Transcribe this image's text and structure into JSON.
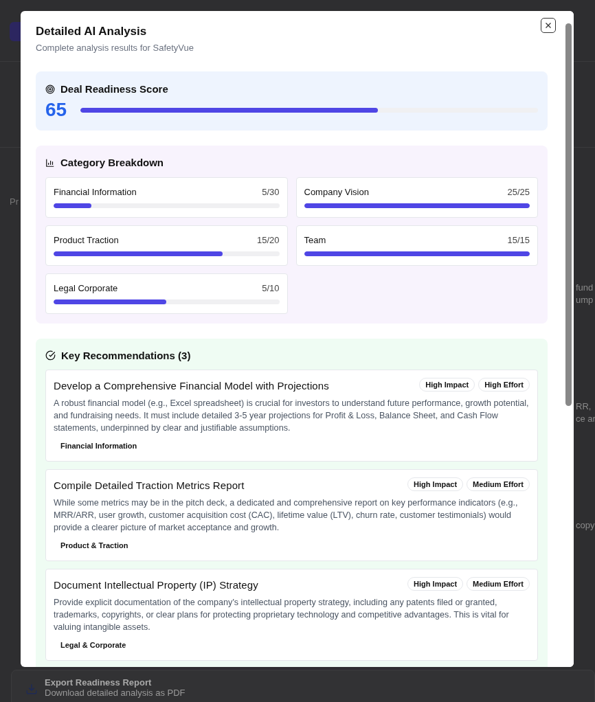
{
  "background": {
    "left_fragments": [
      "Pr"
    ],
    "right_fragments": [
      "fund",
      "ump",
      "RR,",
      "ce ar",
      "copy"
    ],
    "export": {
      "title": "Export Readiness Report",
      "subtitle": "Download detailed analysis as PDF"
    }
  },
  "dialog": {
    "title": "Detailed AI Analysis",
    "subtitle": "Complete analysis results for SafetyVue",
    "score": {
      "title": "Deal Readiness Score",
      "value": "65",
      "level": 0.65
    },
    "breakdown": {
      "title": "Category Breakdown",
      "categories": [
        {
          "name": "Financial Information",
          "score": "5/30",
          "level": 0.167
        },
        {
          "name": "Company Vision",
          "score": "25/25",
          "level": 1
        },
        {
          "name": "Product Traction",
          "score": "15/20",
          "level": 0.75
        },
        {
          "name": "Team",
          "score": "15/15",
          "level": 1
        },
        {
          "name": "Legal Corporate",
          "score": "5/10",
          "level": 0.5
        }
      ]
    },
    "recommendations": {
      "title": "Key Recommendations (3)",
      "items": [
        {
          "title": "Develop a Comprehensive Financial Model with Projections",
          "tags": [
            "High Impact",
            "High Effort"
          ],
          "text": "A robust financial model (e.g., Excel spreadsheet) is crucial for investors to understand future performance, growth potential, and fundraising needs. It must include detailed 3-5 year projections for Profit & Loss, Balance Sheet, and Cash Flow statements, underpinned by clear and justifiable assumptions.",
          "category": "Financial Information"
        },
        {
          "title": "Compile Detailed Traction Metrics Report",
          "tags": [
            "High Impact",
            "Medium Effort"
          ],
          "text": "While some metrics may be in the pitch deck, a dedicated and comprehensive report on key performance indicators (e.g., MRR/ARR, user growth, customer acquisition cost (CAC), lifetime value (LTV), churn rate, customer testimonials) would provide a clearer picture of market acceptance and growth.",
          "category": "Product & Traction"
        },
        {
          "title": "Document Intellectual Property (IP) Strategy",
          "tags": [
            "High Impact",
            "Medium Effort"
          ],
          "text": "Provide explicit documentation of the company's intellectual property strategy, including any patents filed or granted, trademarks, copyrights, or clear plans for protecting proprietary technology and competitive advantages. This is vital for valuing intangible assets.",
          "category": "Legal & Corporate"
        }
      ]
    }
  }
}
